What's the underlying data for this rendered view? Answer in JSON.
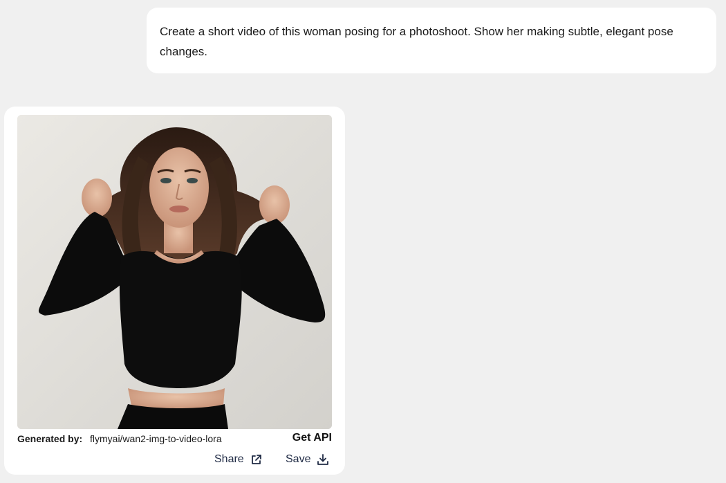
{
  "chat": {
    "user_prompt": "Create a short video of this woman posing for a photoshoot. Show her making subtle, elegant pose changes."
  },
  "result": {
    "image_alt": "Woman in black long-sleeve top lifting her hair",
    "generated_by_label": "Generated by:",
    "model_name": "flymyai/wan2-img-to-video-lora",
    "get_api_label": "Get API",
    "share_label": "Share",
    "save_label": "Save",
    "icons": {
      "share": "external-link-icon",
      "save": "download-icon"
    }
  },
  "colors": {
    "page_background": "#f0f0f0",
    "card_background": "#ffffff",
    "action_text": "#1f2a44"
  }
}
